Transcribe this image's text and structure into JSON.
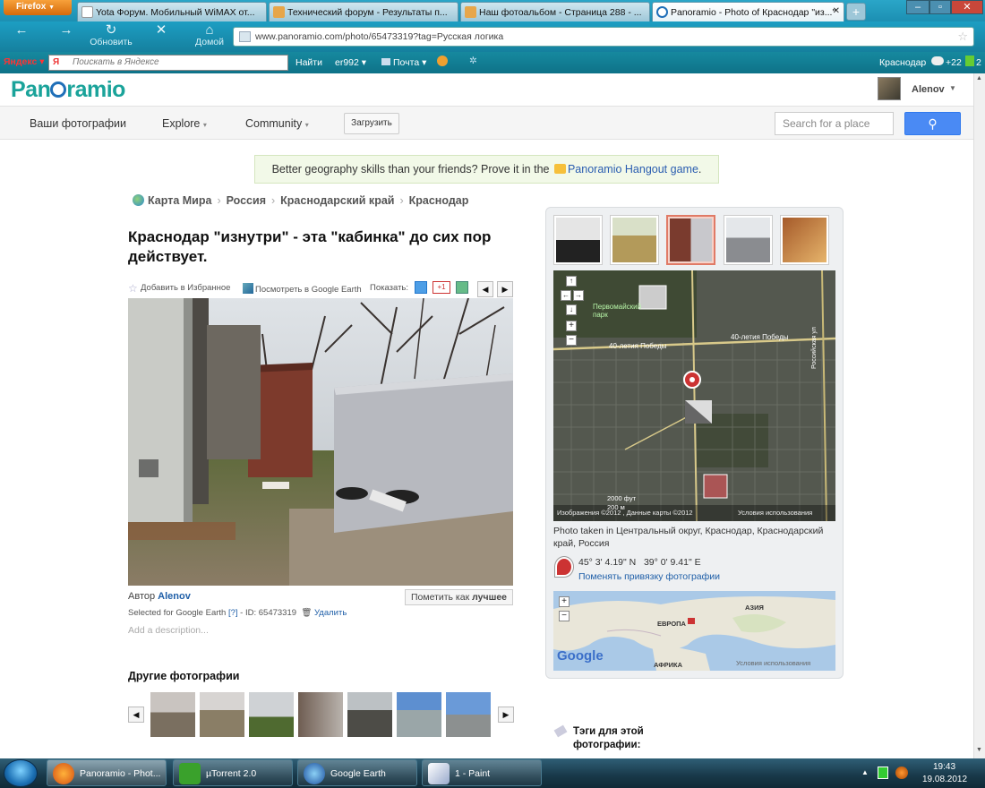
{
  "browser": {
    "menu_button": "Firefox",
    "tabs": [
      {
        "label": "Yota Форум. Мобильный WiMAX от..."
      },
      {
        "label": "Технический форум - Результаты п..."
      },
      {
        "label": "Наш фотоальбом - Страница 288 - ..."
      },
      {
        "label": "Panoramio - Photo of Краснодар \"из...\""
      }
    ],
    "new_tab": "+",
    "nav": {
      "reload": "Обновить",
      "home": "Домой"
    },
    "url": "www.panoramio.com/photo/65473319?tag=Русская логика",
    "yandex": {
      "brand": "Яндекс",
      "search_placeholder": "Поискать в Яндексе",
      "find": "Найти",
      "user": "er992",
      "mail": "Почта",
      "city": "Краснодар",
      "temp": "+22",
      "counter": "2"
    }
  },
  "site": {
    "logo_pre": "Pan",
    "logo_post": "ramio",
    "user": "Alenov",
    "menu": {
      "my_photos": "Ваши фотографии",
      "explore": "Explore",
      "community": "Community",
      "upload": "Загрузить"
    },
    "search_placeholder": "Search for a place",
    "promo_text": "Better geography skills than your friends? Prove it in the",
    "promo_link": "Panoramio Hangout game",
    "promo_end": "."
  },
  "breadcrumb": [
    "Карта Мира",
    "Россия",
    "Краснодарский край",
    "Краснодар"
  ],
  "photo": {
    "title": "Краснодар \"изнутри\" - эта \"кабинка\" до сих пор действует.",
    "favorite": "Добавить в Избранное",
    "google_earth": "Посмотреть в Google Earth",
    "show": "Показать:",
    "plus_one": "+1",
    "author_label": "Автор",
    "author": "Alenov",
    "mark_best_pre": "Пометить как",
    "mark_best_bold": "лучшее",
    "selected_for": "Selected for Google Earth",
    "help": "[?]",
    "id_text": "- ID: 65473319",
    "delete": "Удалить",
    "add_description": "Add a description..."
  },
  "other_photos": {
    "heading": "Другие фотографии",
    "count": 7
  },
  "side": {
    "taken_in": "Photo taken in Центральный округ, Краснодар, Краснодарский край, Россия",
    "coords": "45° 3' 4.19\" N   39° 0' 9.41\" E",
    "change_link": "Поменять привязку фотографии",
    "map_labels": {
      "park": "Первомайский парк",
      "street1": "40-летия Победы",
      "street2": "40-летия Победы",
      "street3": "Российская ул",
      "scale": "200 м",
      "scale2": "2000 фут",
      "attribution": "Изображения ©2012 , Данные карты ©2012",
      "terms": "Условия использования"
    },
    "world_labels": {
      "asia": "АЗИЯ",
      "europe": "ЕВРОПА",
      "africa": "АФРИКА",
      "terms": "Условия использования",
      "google": "Google"
    },
    "tags_heading": "Тэги для этой фотографии:"
  },
  "taskbar": {
    "items": [
      {
        "label": "Panoramio - Phot..."
      },
      {
        "label": "µTorrent 2.0"
      },
      {
        "label": "Google Earth"
      },
      {
        "label": "1 - Paint"
      }
    ],
    "time": "19:43",
    "date": "19.08.2012"
  }
}
